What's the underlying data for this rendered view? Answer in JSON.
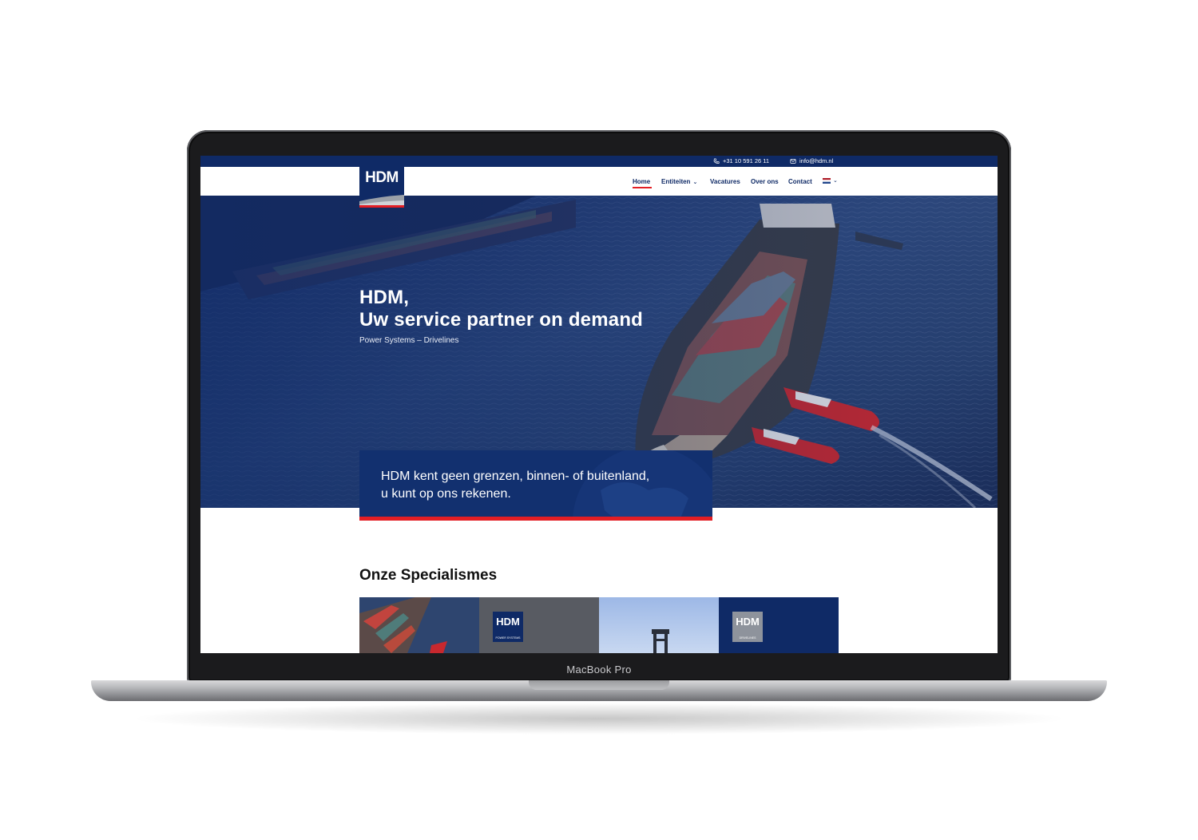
{
  "device": {
    "label": "MacBook Pro"
  },
  "topbar": {
    "phone": "+31 10 591 26 11",
    "email": "info@hdm.nl"
  },
  "logo": {
    "text": "HDM"
  },
  "nav": {
    "items": [
      {
        "label": "Home",
        "active": true
      },
      {
        "label": "Entiteiten",
        "has_dropdown": true
      },
      {
        "label": "Vacatures"
      },
      {
        "label": "Over ons"
      },
      {
        "label": "Contact"
      }
    ],
    "language": "nl"
  },
  "hero": {
    "title_line1": "HDM,",
    "title_line2": "Uw service partner on demand",
    "subtitle": "Power Systems – Drivelines",
    "quote_line1": "HDM kent geen grenzen, binnen- of buitenland,",
    "quote_line2": "u kunt op ons rekenen."
  },
  "specialisms": {
    "heading": "Onze Specialismes",
    "tiles": [
      {
        "logo": ""
      },
      {
        "logo": "HDM",
        "caption": "POWER SYSTEMS"
      },
      {
        "logo": ""
      },
      {
        "logo": "HDM",
        "caption": "DRIVELINES"
      }
    ]
  },
  "colors": {
    "brand_navy": "#0f2a66",
    "accent_red": "#e31e24"
  }
}
